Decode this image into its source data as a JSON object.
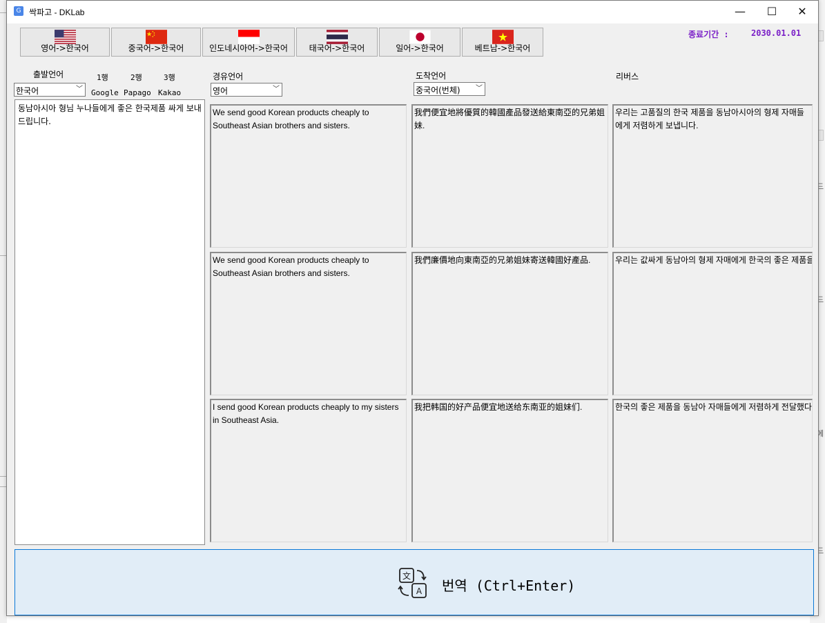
{
  "window": {
    "title": "싹파고 - DKLab",
    "min_glyph": "—",
    "max_glyph": "☐",
    "close_glyph": "✕"
  },
  "lang_buttons": [
    {
      "label": "영어->한국어",
      "flag": "us-flag-icon"
    },
    {
      "label": "중국어->한국어",
      "flag": "china-flag-icon"
    },
    {
      "label": "인도네시아어->한국어",
      "flag": "indonesia-flag-icon"
    },
    {
      "label": "태국어->한국어",
      "flag": "thailand-flag-icon"
    },
    {
      "label": "일어->한국어",
      "flag": "japan-flag-icon"
    },
    {
      "label": "베트남->한국어",
      "flag": "vietnam-flag-icon"
    }
  ],
  "expiry": {
    "label": "종료기간 :",
    "date": "2030.01.01"
  },
  "labels": {
    "source": "출발언어",
    "via": "경유언어",
    "target": "도착언어",
    "reverse": "리버스",
    "row1": "1행",
    "row2": "2행",
    "row3": "3행",
    "engine1": "Google",
    "engine2": "Papago",
    "engine3": "Kakao"
  },
  "selects": {
    "source": "한국어",
    "via": "영어",
    "target": "중국어(번체)"
  },
  "source_text": "동남아시아 형님 누나들에게 좋은 한국제품 싸게 보내 드립니다.",
  "results": {
    "via": [
      "We send good Korean products cheaply to Southeast Asian brothers and sisters.",
      "We send good Korean products cheaply to Southeast Asian brothers and sisters.",
      "I send good Korean products cheaply to my sisters in Southeast Asia."
    ],
    "target": [
      "我們便宜地將優質的韓國產品發送給東南亞的兄弟姐妹.",
      "我們廉價地向東南亞的兄弟姐妹寄送韓國好產品.",
      "我把韩国的好产品便宜地送给东南亚的姐妹们."
    ],
    "reverse": [
      "우리는 고품질의 한국 제품을 동남아시아의 형제 자매들에게 저렴하게 보냅니다.",
      "우리는 값싸게 동남아의 형제 자매에게 한국의 좋은 제품을 보냅니다.",
      "한국의 좋은 제품을 동남아 자매들에게 저렴하게 전달했다."
    ]
  },
  "translate_button": {
    "label": "번역 (Ctrl+Enter)",
    "icon": "translate-icon"
  },
  "colors": {
    "accent": "#0a78d7",
    "expiry": "#7a1fc7",
    "button_bg": "#e1edf7"
  }
}
